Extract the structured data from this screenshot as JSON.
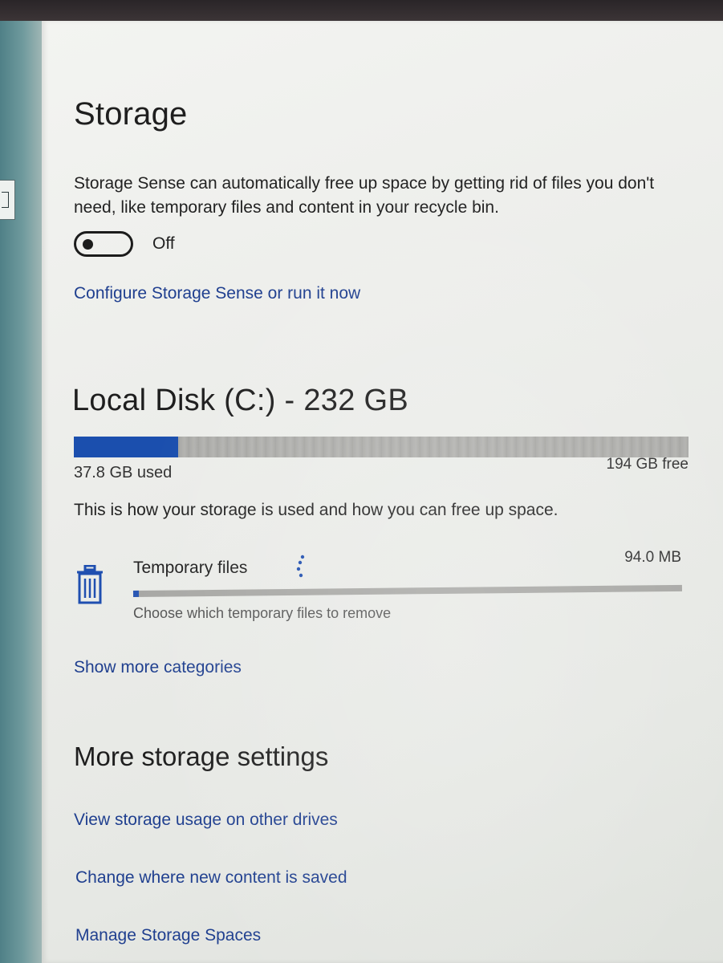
{
  "storage": {
    "title": "Storage",
    "description": "Storage Sense can automatically free up space by getting rid of files you don't need, like temporary files and content in your recycle bin.",
    "toggle_state": "Off",
    "configure_link": "Configure Storage Sense or run it now"
  },
  "disk": {
    "title": "Local Disk (C:) - 232 GB",
    "used_label": "37.8 GB used",
    "free_label": "194 GB free",
    "used_fraction": 0.17,
    "accent_color": "#1b4fae"
  },
  "usage": {
    "info": "This is how your storage is used and how you can free up space.",
    "categories": [
      {
        "icon": "trash-icon",
        "name": "Temporary files",
        "size": "94.0 MB",
        "subtitle": "Choose which temporary files to remove",
        "fraction": 0.01
      }
    ],
    "show_more_link": "Show more categories"
  },
  "more_settings": {
    "title": "More storage settings",
    "links": [
      "View storage usage on other drives",
      "Change where new content is saved",
      "Manage Storage Spaces"
    ]
  }
}
